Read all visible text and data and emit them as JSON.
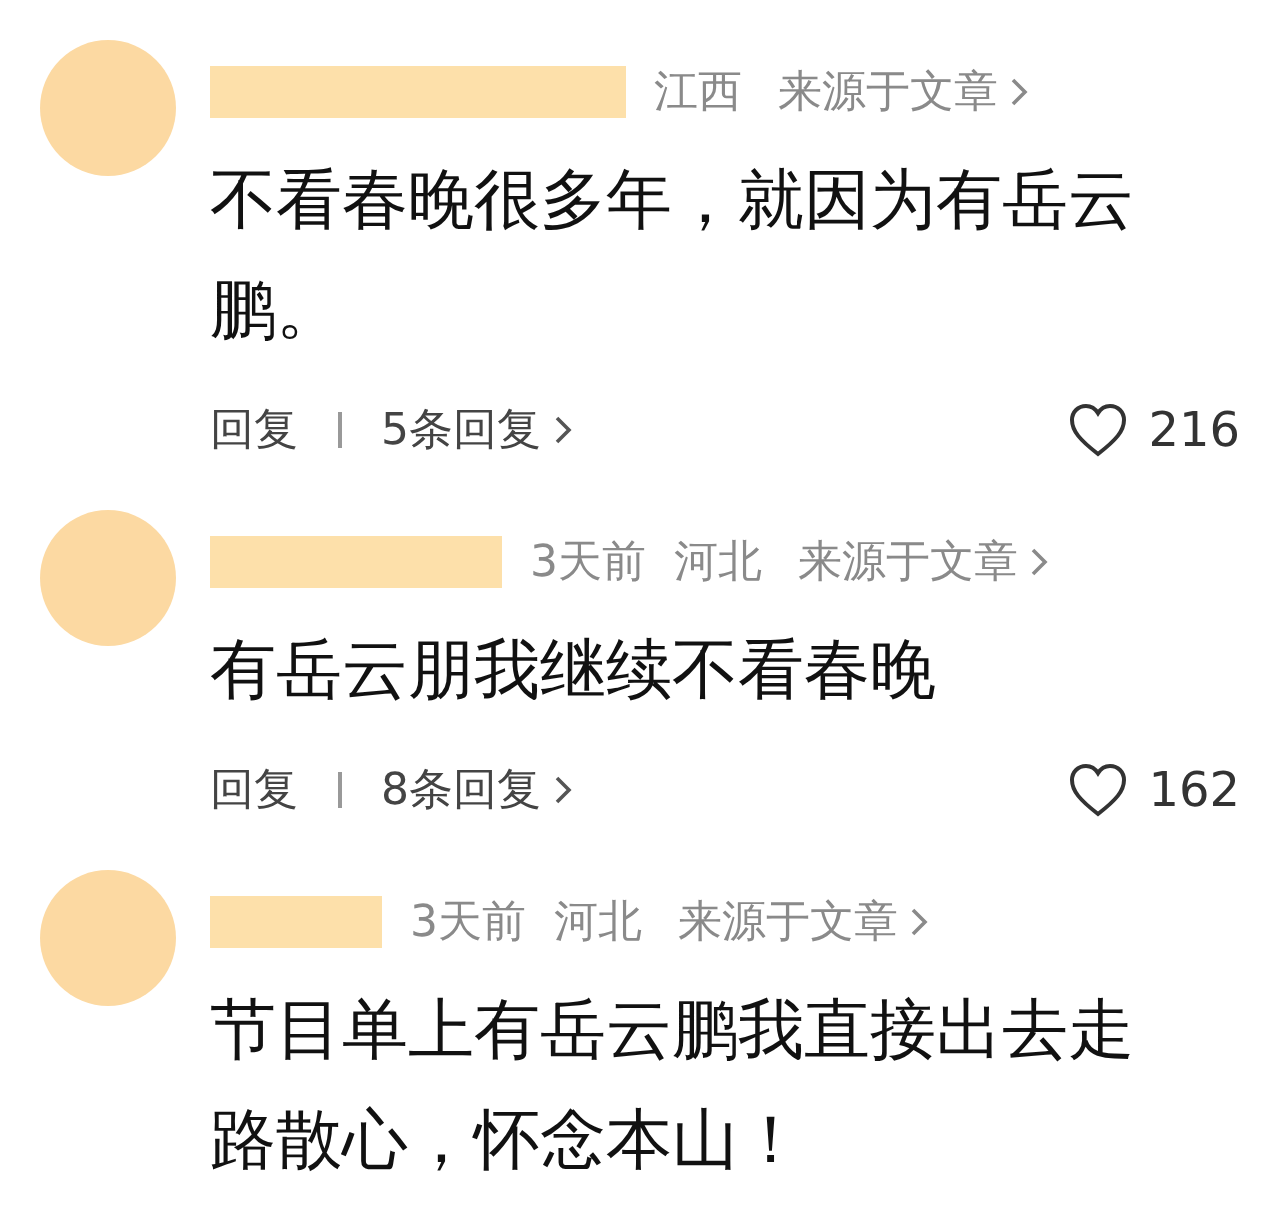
{
  "comments": [
    {
      "location": "江西",
      "source": "来源于文章",
      "body": "不看春晚很多年，就因为有岳云鹏。",
      "reply": "回复",
      "replies": "5条回复",
      "likes": "216"
    },
    {
      "time": "3天前",
      "location": "河北",
      "source": "来源于文章",
      "body": "有岳云朋我继续不看春晚",
      "reply": "回复",
      "replies": "8条回复",
      "likes": "162"
    },
    {
      "time": "3天前",
      "location": "河北",
      "source": "来源于文章",
      "body": "节目单上有岳云鹏我直接出去走路散心，怀念本山！"
    }
  ]
}
